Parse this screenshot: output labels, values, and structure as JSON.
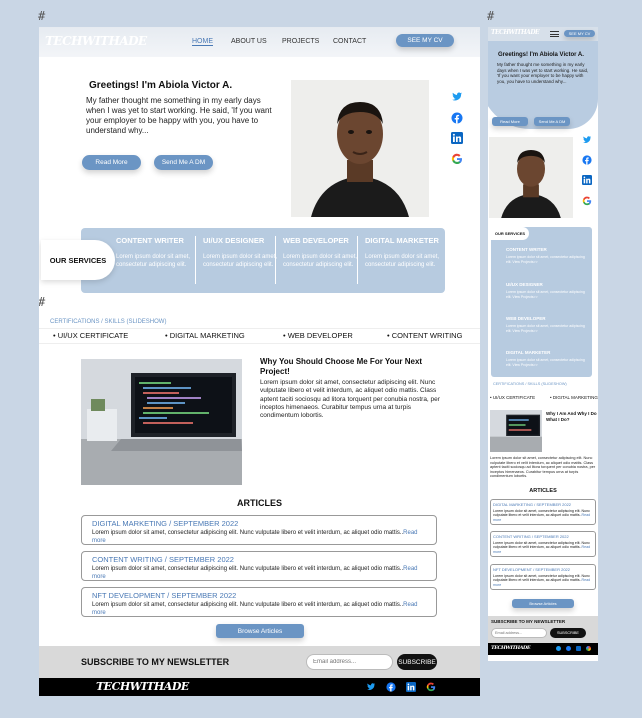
{
  "hash_marks": [
    "#",
    "#",
    "#"
  ],
  "brand": {
    "logo": "TECHWITHADE"
  },
  "nav": {
    "items": [
      "HOME",
      "ABOUT US",
      "PROJECTS",
      "CONTACT"
    ],
    "cta": "SEE MY CV"
  },
  "hero": {
    "title": "Greetings! I'm Abiola Victor A.",
    "text": "My father thought me something in my early days when I was yet to start working. He said, 'If you want your employer to be happy with you, you have to understand why...",
    "read_more": "Read More",
    "send_dm": "Send Me A DM"
  },
  "socials": [
    "twitter-icon",
    "facebook-icon",
    "linkedin-icon",
    "google-icon"
  ],
  "services": {
    "badge": "OUR SERVICES",
    "items": [
      {
        "title": "CONTENT WRITER",
        "desc": "Lorem ipsum dolor sit amet, consectetur adipiscing elit."
      },
      {
        "title": "UI/UX DESIGNER",
        "desc": "Lorem ipsum dolor sit amet, consectetur adipiscing elit."
      },
      {
        "title": "WEB DEVELOPER",
        "desc": "Lorem ipsum dolor sit amet, consectetur adipiscing elit."
      },
      {
        "title": "DIGITAL MARKETER",
        "desc": "Lorem ipsum dolor sit amet, consectetur adipiscing elit."
      }
    ]
  },
  "certifications": {
    "title": "CERTIFICATIONS / SKILLS (SLIDESHOW)",
    "items": [
      "UI/UX CERTIFICATE",
      "DIGITAL MARKETING",
      "WEB DEVELOPER",
      "CONTENT WRITING"
    ]
  },
  "why": {
    "title": "Why You Should Choose Me For Your Next Project!",
    "text": "Lorem ipsum dolor sit amet, consectetur adipiscing elit. Nunc vulputate libero et velit interdum, ac aliquet odio mattis. Class aptent taciti sociosqu ad litora torquent per conubia nostra, per inceptos himenaeos. Curabitur tempus urna at turpis condimentum lobortis."
  },
  "articles": {
    "heading": "ARTICLES",
    "items": [
      {
        "title": "DIGITAL MARKETING / SEPTEMBER 2022",
        "text": "Lorem ipsum dolor sit amet, consectetur adipiscing elit. Nunc vulputate libero et velit interdum, ac aliquet odio mattis..",
        "more": "Read more"
      },
      {
        "title": "CONTENT WRITING / SEPTEMBER 2022",
        "text": "Lorem ipsum dolor sit amet, consectetur adipiscing elit. Nunc vulputate libero et velit interdum, ac aliquet odio mattis..",
        "more": "Read more"
      },
      {
        "title": "NFT DEVELOPMENT / SEPTEMBER 2022",
        "text": "Lorem ipsum dolor sit amet, consectetur adipiscing elit. Nunc vulputate libero et velit interdum, ac aliquet odio mattis..",
        "more": "Read more"
      }
    ],
    "browse": "Browse Articles"
  },
  "newsletter": {
    "label": "SUBSCRIBE TO MY NEWSLETTER",
    "placeholder": "Email address...",
    "button": "SUBSCRIBE"
  },
  "mobile": {
    "cta": "SEE MY CV",
    "hero_title": "Greetings! I'm Abiola Victor A.",
    "hero_text": "My father thought me something in my early days when I was yet to start working. He said, 'If you want your employer to be happy with you, you have to understand why...",
    "read_more": "Read More",
    "send_dm": "Send Me A DM",
    "services_badge": "OUR SERVICES",
    "services": [
      {
        "title": "CONTENT WRITER",
        "desc": "Lorem ipsum dolor sit amet, consectetur adipiscing elit. View Projects>>"
      },
      {
        "title": "UI/UX DESIGNER",
        "desc": "Lorem ipsum dolor sit amet, consectetur adipiscing elit. View Projects>>"
      },
      {
        "title": "WEB DEVELOPER",
        "desc": "Lorem ipsum dolor sit amet, consectetur adipiscing elit. View Projects>>"
      },
      {
        "title": "DIGITAL MARKETER",
        "desc": "Lorem ipsum dolor sit amet, consectetur adipiscing elit. View Projects>>"
      }
    ],
    "cert_title": "CERTIFICATIONS / SKILLS (SLIDESHOW)",
    "cert_items": [
      "UI/UX CERTIFICATE",
      "DIGITAL MARKETING"
    ],
    "why_title": "Why I Am And Why I Do What I Do?",
    "why_text": "Lorem ipsum dolor sit amet, consectetur adipiscing elit. Nunc vulputate libero et velit interdum, ac aliquet odio mattis. Class aptent taciti sociosqu ad litora torquent per conubia nostra, per inceptos himenaeos. Curabitur tempus urna at turpis condimentum lobortis.",
    "articles_heading": "ARTICLES",
    "articles": [
      {
        "title": "DIGITAL MARKETING / SEPTEMBER 2022",
        "text": "Lorem ipsum dolor sit amet, consectetur adipiscing elit. Nunc vulputate libero et velit interdum, ac aliquet odio mattis..",
        "more": "Read more"
      },
      {
        "title": "CONTENT WRITING / SEPTEMBER 2022",
        "text": "Lorem ipsum dolor sit amet, consectetur adipiscing elit. Nunc vulputate libero et velit interdum, ac aliquet odio mattis..",
        "more": "Read more"
      },
      {
        "title": "NFT DEVELOPMENT / SEPTEMBER 2022",
        "text": "Lorem ipsum dolor sit amet, consectetur adipiscing elit. Nunc vulputate libero et velit interdum, ac aliquet odio mattis..",
        "more": "Read more"
      }
    ],
    "browse": "Browse Articles",
    "newsletter_label": "SUBSCRIBE TO MY NEWSLETTER",
    "newsletter_placeholder": "Email address...",
    "newsletter_button": "SUBSCRIBE",
    "footer_logo": "TECHWITHADE"
  },
  "colors": {
    "accent": "#6b95c4",
    "link": "#4a79b5",
    "background": "#c9d6e5",
    "services_panel": "#b7cbe0"
  }
}
